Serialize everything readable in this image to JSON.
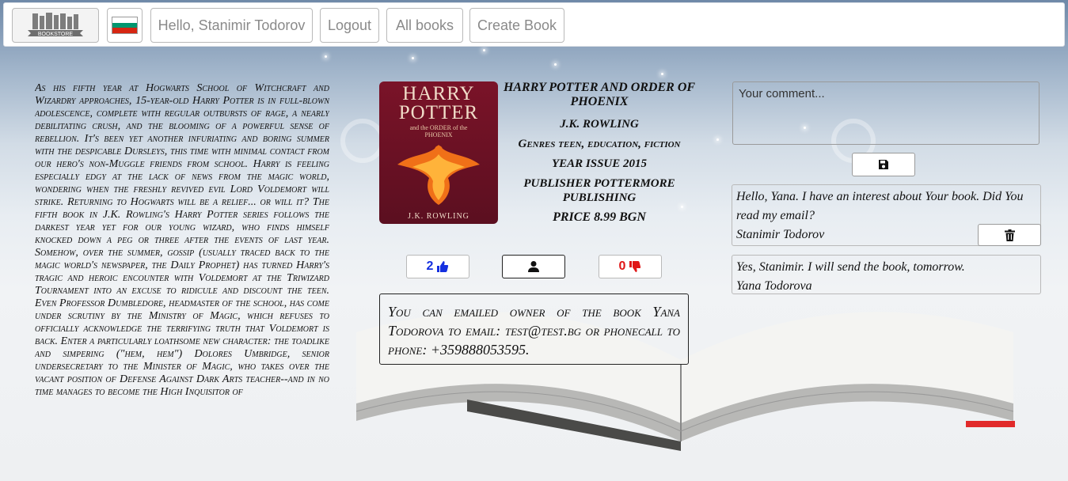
{
  "nav": {
    "logo_text": "BOOKSTORE",
    "flag_colors": [
      "#ffffff",
      "#00966e",
      "#d62612"
    ],
    "greeting": "Hello, Stanimir Todorov",
    "logout": "Logout",
    "all_books": "All books",
    "create_book": "Create Book"
  },
  "book": {
    "description": "As his fifth year at Hogwarts School of Witchcraft and Wizardry approaches, 15-year-old Harry Potter is in full-blown adolescence, complete with regular outbursts of rage, a nearly debilitating crush, and the blooming of a powerful sense of rebellion. It's been yet another infuriating and boring summer with the despicable Dursleys, this time with minimal contact from our hero's non-Muggle friends from school. Harry is feeling especially edgy at the lack of news from the magic world, wondering when the freshly revived evil Lord Voldemort will strike. Returning to Hogwarts will be a relief... or will it? The fifth book in J.K. Rowling's Harry Potter series follows the darkest year yet for our young wizard, who finds himself knocked down a peg or three after the events of last year. Somehow, over the summer, gossip (usually traced back to the magic world's newspaper, the Daily Prophet) has turned Harry's tragic and heroic encounter with Voldemort at the Triwizard Tournament into an excuse to ridicule and discount the teen. Even Professor Dumbledore, headmaster of the school, has come under scrutiny by the Ministry of Magic, which refuses to officially acknowledge the terrifying truth that Voldemort is back. Enter a particularly loathsome new character: the toadlike and simpering (\"hem, hem\") Dolores Umbridge, senior undersecretary to the Minister of Magic, who takes over the vacant position of Defense Against Dark Arts teacher--and in no time manages to become the High Inquisitor of",
    "cover_title": "HARRY POTTER",
    "cover_subtitle": "and the ORDER of the PHOENIX",
    "cover_author": "J.K. ROWLING",
    "title": "HARRY POTTER AND ORDER OF PHOENIX",
    "author": "J.K. ROWLING",
    "genres": "Genres teen, education, fiction",
    "year": "YEAR ISSUE 2015",
    "publisher": "PUBLISHER POTTERMORE PUBLISHING",
    "price": "PRICE 8.99 BGN"
  },
  "actions": {
    "likes": "2",
    "dislikes": "0"
  },
  "contact": "You can emailed owner of the book Yana Todorova to email: test@test.bg or phonecall to phone: +359888053595.",
  "comment_form": {
    "placeholder": "Your comment..."
  },
  "comments": [
    {
      "text": "Hello, Yana. I have an interest about Your book. Did You read my email?",
      "author": "Stanimir Todorov"
    },
    {
      "text": "Yes, Stanimir. I will send the book, tomorrow.",
      "author": "Yana Todorova"
    }
  ]
}
